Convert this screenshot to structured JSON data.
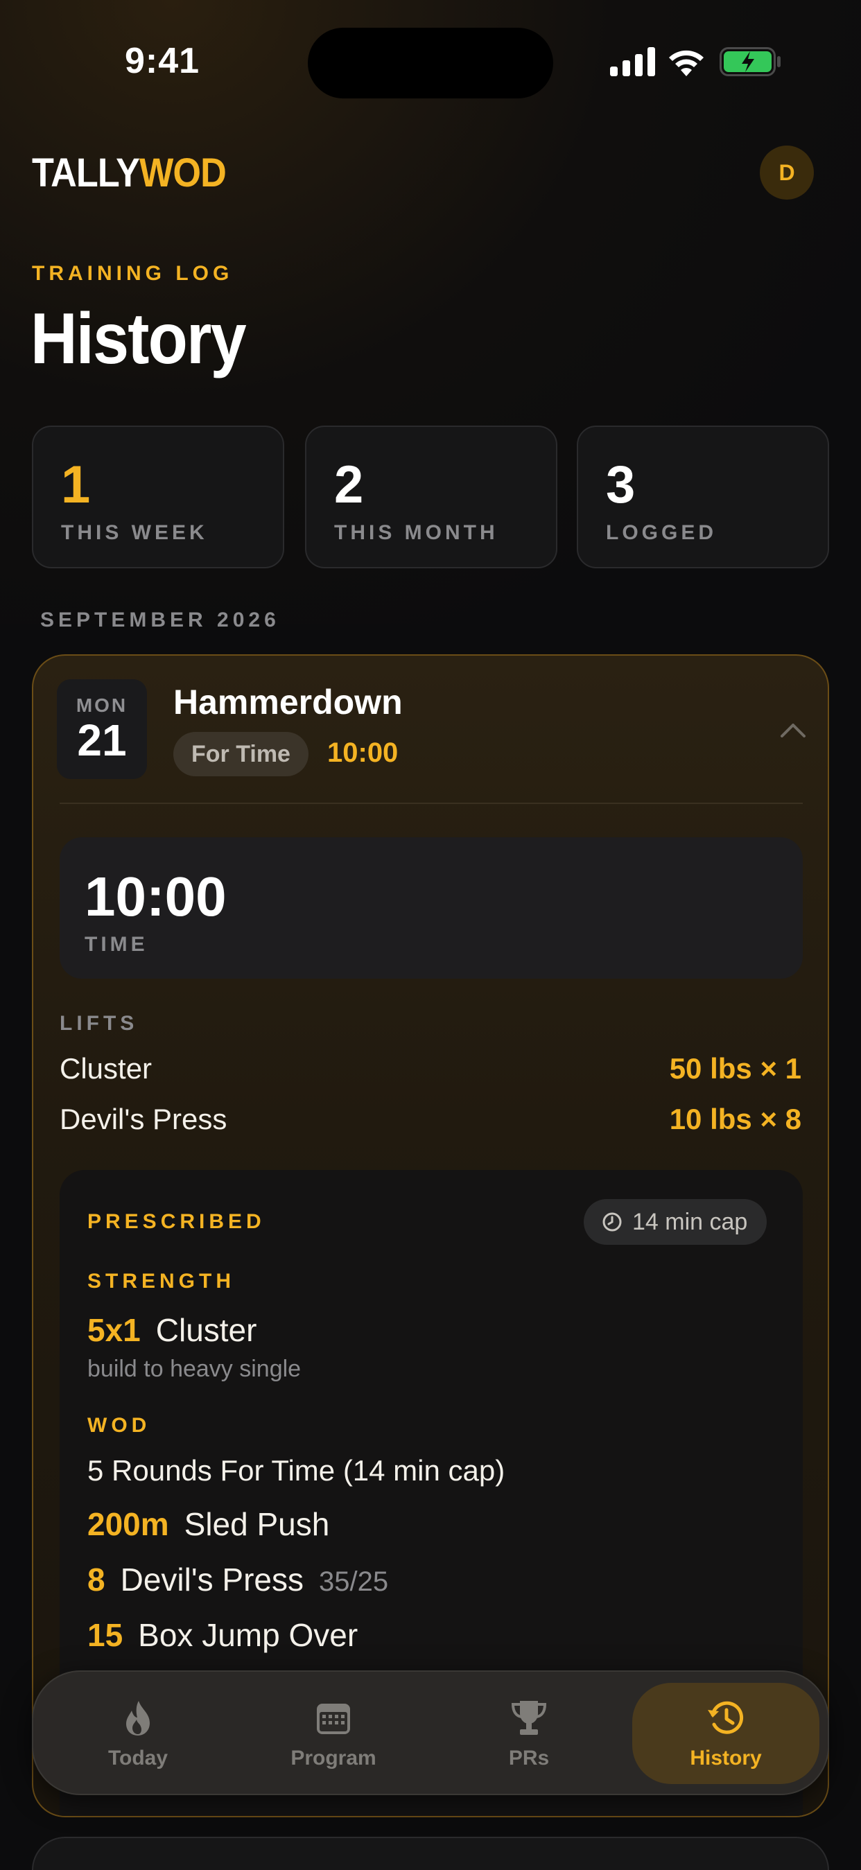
{
  "status_bar": {
    "time": "9:41"
  },
  "header": {
    "logo_part1": "TALLY",
    "logo_part2": "WOD",
    "avatar_initial": "D"
  },
  "page": {
    "eyebrow": "TRAINING LOG",
    "title": "History"
  },
  "stats": [
    {
      "value": "1",
      "label": "THIS WEEK"
    },
    {
      "value": "2",
      "label": "THIS MONTH"
    },
    {
      "value": "3",
      "label": "LOGGED"
    }
  ],
  "month_header": "SEPTEMBER 2026",
  "entry": {
    "day_of_week": "MON",
    "day": "21",
    "name": "Hammerdown",
    "type": "For Time",
    "result": "10:00",
    "result_value": "10:00",
    "result_label": "TIME",
    "lifts_header": "LIFTS",
    "lifts": [
      {
        "name": "Cluster",
        "value": "50 lbs × 1"
      },
      {
        "name": "Devil's Press",
        "value": "10 lbs × 8"
      }
    ],
    "prescribed": {
      "header": "PRESCRIBED",
      "cap": "14 min cap",
      "strength_header": "STRENGTH",
      "strength_qty": "5x1",
      "strength_move": "Cluster",
      "strength_note": "build to heavy single",
      "wod_header": "WOD",
      "wod_description": "5 Rounds For Time (14 min cap)",
      "movements": [
        {
          "qty": "200m",
          "name": "Sled Push",
          "sub": ""
        },
        {
          "qty": "8",
          "name": "Devil's Press",
          "sub": "35/25"
        },
        {
          "qty": "15",
          "name": "Box Jump Over",
          "sub": ""
        }
      ]
    }
  },
  "tabs": [
    {
      "label": "Today",
      "icon": "flame-icon"
    },
    {
      "label": "Program",
      "icon": "calendar-icon"
    },
    {
      "label": "PRs",
      "icon": "trophy-icon"
    },
    {
      "label": "History",
      "icon": "history-icon"
    }
  ],
  "colors": {
    "accent": "#f4b323",
    "background": "#0c0c0d",
    "card_border": "#6b4d16"
  }
}
